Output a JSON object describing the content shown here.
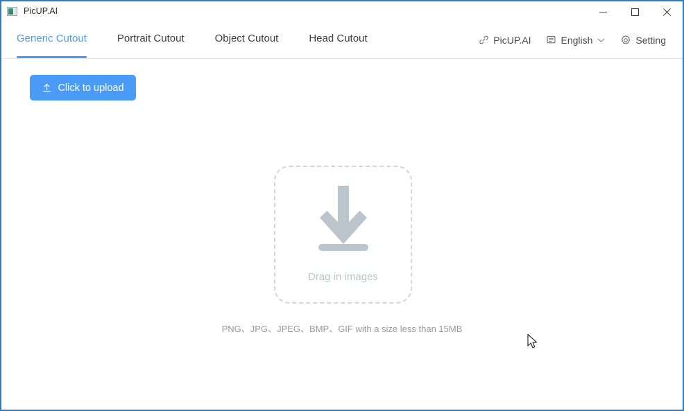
{
  "window": {
    "title": "PicUP.AI",
    "app_icon": "picture-icon",
    "border_color": "#2a7cc7",
    "controls": [
      {
        "name": "minimize",
        "glyph": "minimize-icon"
      },
      {
        "name": "maximize",
        "glyph": "maximize-icon"
      },
      {
        "name": "close",
        "glyph": "close-icon"
      }
    ]
  },
  "header": {
    "accent_color": "#4a9bf5",
    "tabs": [
      {
        "label": "Generic Cutout",
        "active": true
      },
      {
        "label": "Portrait Cutout",
        "active": false
      },
      {
        "label": "Object Cutout",
        "active": false
      },
      {
        "label": "Head Cutout",
        "active": false
      }
    ],
    "right": {
      "link": {
        "label": "PicUP.AI",
        "icon": "link-icon"
      },
      "language": {
        "label": "English",
        "icon": "translate-icon",
        "chevron": "chevron-down-icon"
      },
      "setting": {
        "label": "Setting",
        "icon": "gear-icon"
      }
    }
  },
  "main": {
    "upload_button": {
      "label": "Click to upload",
      "icon": "upload-icon",
      "color": "#4a9bf5"
    },
    "dropzone": {
      "label": "Drag in images",
      "icon": "download-arrow-icon",
      "border_color": "#cfd6dc"
    },
    "hint": "PNG、JPG、JPEG、BMP、GIF with a size less than 15MB"
  }
}
